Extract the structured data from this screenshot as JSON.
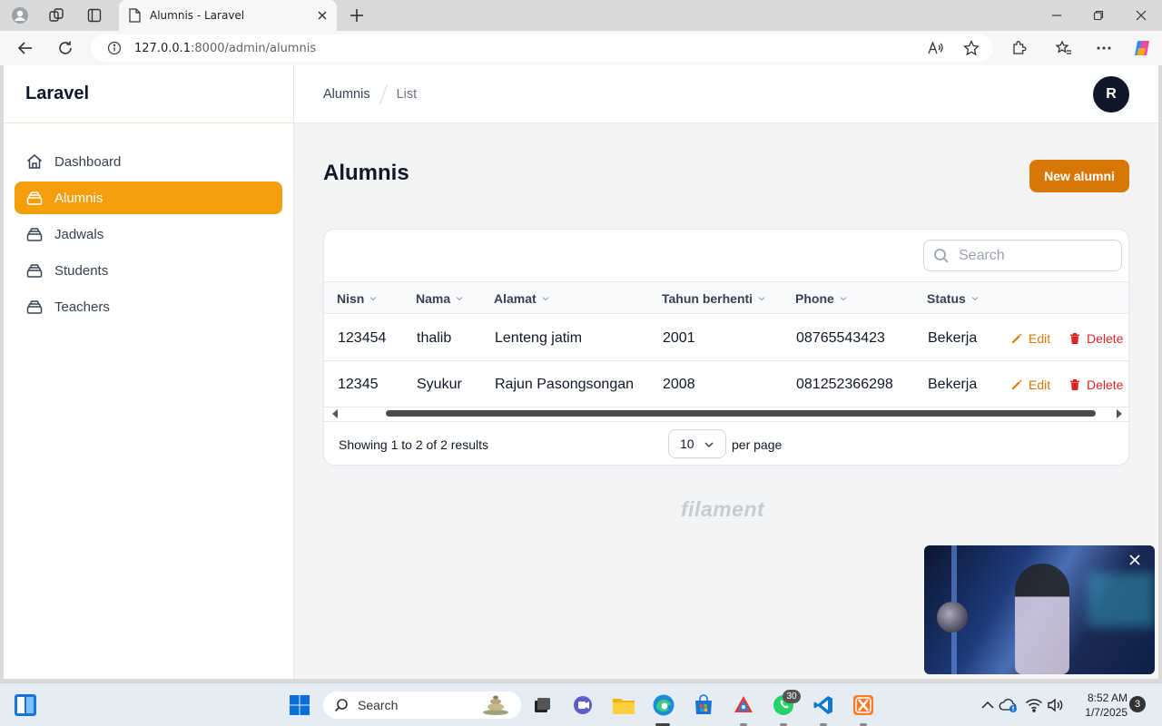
{
  "browser": {
    "tab_title": "Alumnis - Laravel",
    "url_host": "127.0.0.1",
    "url_rest": ":8000/admin/alumnis"
  },
  "app": {
    "brand": "Laravel",
    "avatar_initial": "R",
    "accent_color": "#f59e0b",
    "primary_button_color": "#d97706"
  },
  "sidebar": {
    "items": [
      {
        "label": "Dashboard",
        "icon": "home-icon",
        "active": false
      },
      {
        "label": "Alumnis",
        "icon": "collection-icon",
        "active": true
      },
      {
        "label": "Jadwals",
        "icon": "collection-icon",
        "active": false
      },
      {
        "label": "Students",
        "icon": "collection-icon",
        "active": false
      },
      {
        "label": "Teachers",
        "icon": "collection-icon",
        "active": false
      }
    ]
  },
  "breadcrumb": {
    "first": "Alumnis",
    "second": "List"
  },
  "page": {
    "title": "Alumnis",
    "new_button": "New alumni"
  },
  "table": {
    "search_placeholder": "Search",
    "columns": [
      "Nisn",
      "Nama",
      "Alamat",
      "Tahun berhenti",
      "Phone",
      "Status"
    ],
    "rows": [
      {
        "nisn": "123454",
        "nama": "thalib",
        "alamat": "Lenteng jatim",
        "tahun": "2001",
        "phone": "08765543423",
        "status": "Bekerja"
      },
      {
        "nisn": "12345",
        "nama": "Syukur",
        "alamat": "Rajun Pasongsongan",
        "tahun": "2008",
        "phone": "081252366298",
        "status": "Bekerja"
      }
    ],
    "edit_label": "Edit",
    "delete_label": "Delete",
    "showing": "Showing 1 to 2 of 2 results",
    "per_page_value": "10",
    "per_page_label": "per page"
  },
  "footer_brand": "filament",
  "taskbar": {
    "search_label": "Search",
    "whatsapp_badge": "30",
    "time": "8:52 AM",
    "date": "1/7/2025",
    "notifications": "3"
  }
}
